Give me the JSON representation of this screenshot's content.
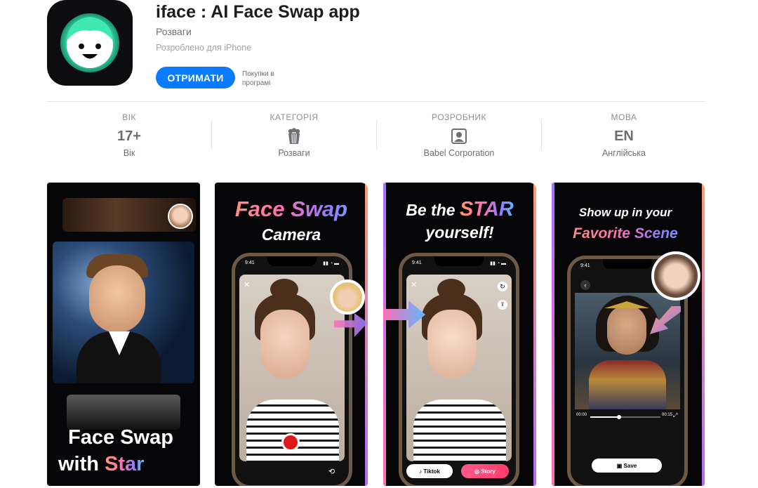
{
  "app": {
    "title": "iface : AI Face Swap app",
    "category": "Розваги",
    "designed_for": "Розроблено для iPhone",
    "get_label": "ОТРИМАТИ",
    "in_app_purchases": "Покупки в програмі",
    "icon": "smiling-face-icon",
    "accent_color": "#0a7bff",
    "icon_glow_color": "#3fe8b0"
  },
  "info": [
    {
      "header": "ВІК",
      "value": "17+",
      "sub": "Вік"
    },
    {
      "header": "КАТЕГОРІЯ",
      "icon": "popcorn-icon",
      "sub": "Розваги"
    },
    {
      "header": "РОЗРОБНИК",
      "icon": "person-badge-icon",
      "sub": "Babel Corporation"
    },
    {
      "header": "МОВА",
      "value": "EN",
      "sub": "Англійська"
    }
  ],
  "screenshots": [
    {
      "headline_line1": "Face Swap",
      "headline_line2_prefix": "with ",
      "headline_line2_accent": "Star"
    },
    {
      "headline_line1": "Face Swap",
      "headline_line2": "Camera",
      "time": "9:41"
    },
    {
      "headline_line1_prefix": "Be the ",
      "headline_line1_accent": "STAR",
      "headline_line2": "yourself!",
      "time": "9:41",
      "tiktok": "Tiktok",
      "story": "Story"
    },
    {
      "headline_line1": "Show up in your",
      "headline_line2": "Favorite Scene",
      "time": "9:41",
      "video_start": "00:00",
      "video_end": "00:15",
      "save": "Save"
    }
  ]
}
